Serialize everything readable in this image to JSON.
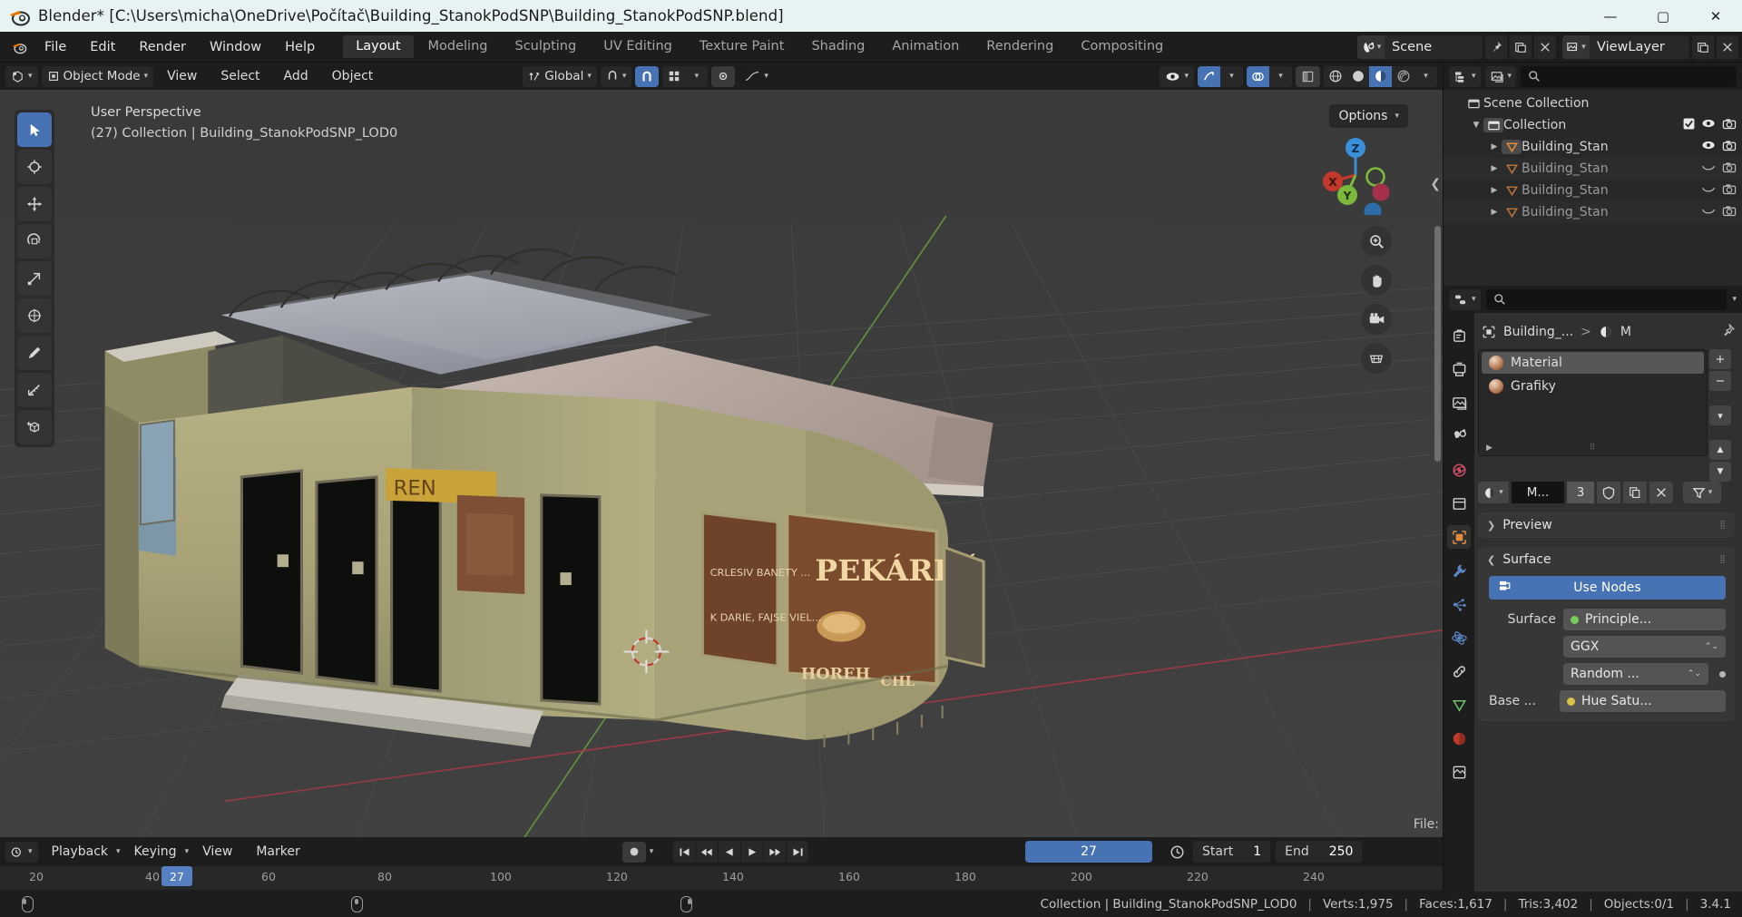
{
  "window": {
    "title": "Blender* [C:\\Users\\micha\\OneDrive\\Počítač\\Building_StanokPodSNP\\Building_StanokPodSNP.blend]",
    "minimize": "—",
    "maximize": "▢",
    "close": "✕"
  },
  "topbar": {
    "menus": [
      "File",
      "Edit",
      "Render",
      "Window",
      "Help"
    ],
    "workspaces": [
      "Layout",
      "Modeling",
      "Sculpting",
      "UV Editing",
      "Texture Paint",
      "Shading",
      "Animation",
      "Rendering",
      "Compositing"
    ],
    "active_workspace": "Layout",
    "scene_name": "Scene",
    "view_layer_name": "ViewLayer",
    "scene_icon": "scene-icon",
    "pin_icon": "pin-icon",
    "new_scene_icon": "new-scene-icon",
    "remove_scene_icon": "remove-scene-icon",
    "view_layer_icon": "view-layer-icon",
    "new_layer_icon": "new-layer-icon",
    "remove_layer_icon": "remove-layer-icon"
  },
  "viewport_header": {
    "editor_type_icon": "editor-type-icon",
    "mode": "Object Mode",
    "menus": [
      "View",
      "Select",
      "Add",
      "Object"
    ],
    "transform_orientation": "Global",
    "snap_icon": "magnet-icon",
    "proportional_icon": "proportional-edit-icon",
    "visibility_icon": "eye-icon",
    "gizmo_icon": "gizmo-icon",
    "overlays_icon": "overlays-icon",
    "xray_icon": "xray-icon",
    "shading_modes": [
      "wireframe",
      "solid",
      "material-preview",
      "rendered"
    ],
    "active_shading": "material-preview",
    "options_label": "Options"
  },
  "viewport": {
    "perspective_label": "User Perspective",
    "collection_label": "(27) Collection | Building_StanokPodSNP_LOD0",
    "gizmo_axes": [
      "Z",
      "X",
      "Y"
    ],
    "file_label": "File:",
    "tools": [
      {
        "name": "tweak-tool",
        "active": true
      },
      {
        "name": "cursor-tool",
        "active": false
      },
      {
        "name": "move-tool",
        "active": false
      },
      {
        "name": "rotate-tool",
        "active": false
      },
      {
        "name": "scale-tool",
        "active": false
      },
      {
        "name": "transform-tool",
        "active": false
      },
      {
        "name": "annotate-tool",
        "active": false
      },
      {
        "name": "measure-tool",
        "active": false
      },
      {
        "name": "add-cube-tool",
        "active": false
      }
    ],
    "nav_buttons": [
      "zoom-icon",
      "pan-icon",
      "camera-icon",
      "ortho-persp-icon"
    ]
  },
  "timeline": {
    "editor_icon": "timeline-editor-icon",
    "menus": [
      "Playback",
      "Keying",
      "View",
      "Marker"
    ],
    "record_icon": "auto-keying-icon",
    "transport": [
      "jump-to-start",
      "prev-keyframe",
      "play-reverse",
      "play",
      "next-keyframe",
      "jump-to-end"
    ],
    "current_frame": "27",
    "clock_icon": "clock-icon",
    "start_label": "Start",
    "start_value": "1",
    "end_label": "End",
    "end_value": "250",
    "ruler_ticks": [
      "20",
      "40",
      "60",
      "80",
      "100",
      "120",
      "140",
      "160",
      "180",
      "200",
      "220",
      "240"
    ],
    "playhead_frame": "27"
  },
  "outliner": {
    "display_mode_icon": "outliner-display-mode-icon",
    "filter_icon": "outliner-filter-icon",
    "search_placeholder": "",
    "search_icon": "search-icon",
    "rows": [
      {
        "name": "Scene Collection",
        "icon": "collection-icon",
        "indent": 0,
        "expander": "",
        "dim": false,
        "checkbox": false,
        "eye": false,
        "camera": false,
        "selected": false
      },
      {
        "name": "Collection",
        "icon": "collection-icon",
        "indent": 1,
        "expander": "▼",
        "dim": false,
        "checkbox": true,
        "eye": "open",
        "camera": true,
        "selected": false
      },
      {
        "name": "Building_Stan",
        "icon": "mesh-icon",
        "indent": 2,
        "expander": "▶",
        "dim": false,
        "checkbox": false,
        "eye": "open",
        "camera": true,
        "selected": true
      },
      {
        "name": "Building_Stan",
        "icon": "mesh-icon",
        "indent": 2,
        "expander": "▶",
        "dim": true,
        "checkbox": false,
        "eye": "closed",
        "camera": true,
        "selected": false
      },
      {
        "name": "Building_Stan",
        "icon": "mesh-icon",
        "indent": 2,
        "expander": "▶",
        "dim": true,
        "checkbox": false,
        "eye": "closed",
        "camera": true,
        "selected": false
      },
      {
        "name": "Building_Stan",
        "icon": "mesh-icon",
        "indent": 2,
        "expander": "▶",
        "dim": true,
        "checkbox": false,
        "eye": "closed",
        "camera": true,
        "selected": false
      }
    ]
  },
  "properties": {
    "editor_icon": "properties-editor-icon",
    "search_icon": "search-icon",
    "tabs": [
      {
        "name": "tool-tab",
        "active": false
      },
      {
        "name": "render-tab",
        "active": false
      },
      {
        "name": "output-tab",
        "active": false
      },
      {
        "name": "view-layer-tab",
        "active": false
      },
      {
        "name": "scene-tab",
        "active": false
      },
      {
        "name": "world-tab",
        "active": false
      },
      {
        "name": "collection-tab",
        "active": false
      },
      {
        "name": "object-tab",
        "active": false
      },
      {
        "name": "modifier-tab",
        "active": false
      },
      {
        "name": "particles-tab",
        "active": false
      },
      {
        "name": "physics-tab",
        "active": false
      },
      {
        "name": "constraint-tab",
        "active": false
      },
      {
        "name": "data-tab",
        "active": false
      },
      {
        "name": "material-tab",
        "active": true
      }
    ],
    "breadcrumb_object": "Building_...",
    "breadcrumb_sep": ">",
    "breadcrumb_material": "M",
    "pin_icon": "pin-icon",
    "material_slots": [
      {
        "name": "Material",
        "selected": true
      },
      {
        "name": "Grafiky",
        "selected": false
      }
    ],
    "slot_buttons": [
      "+",
      "−",
      "⌄",
      "▲",
      "▼"
    ],
    "datablock": {
      "browse_icon": "browse-material-icon",
      "name": "M...",
      "users": "3",
      "shield_icon": "fake-user-icon",
      "copy_icon": "new-material-icon",
      "unlink_icon": "unlink-icon",
      "slot_icon": "material-slot-icon"
    },
    "panels": [
      {
        "label": "Preview",
        "expanded": false
      },
      {
        "label": "Surface",
        "expanded": true
      }
    ],
    "use_nodes_label": "Use Nodes",
    "surface_rows": [
      {
        "label": "Surface",
        "value": "Principle...",
        "dot": "green"
      },
      {
        "label": "",
        "value": "GGX",
        "dot": "none"
      },
      {
        "label": "",
        "value": "Random ...",
        "dot": "none"
      },
      {
        "label": "Base ...",
        "value": "Hue Satu...",
        "dot": "yellow"
      }
    ]
  },
  "statusbar": {
    "mouse_hints": [
      "select",
      "",
      ""
    ],
    "scene_stats": "Collection | Building_StanokPodSNP_LOD0",
    "verts": "Verts:1,975",
    "faces": "Faces:1,617",
    "tris": "Tris:3,402",
    "objects": "Objects:0/1",
    "version": "3.4.1"
  },
  "colors": {
    "accent_blue": "#4772b3",
    "panel_bg": "#303030",
    "editor_bg": "#1d1d1d",
    "viewport_bg": "#3d3d3d",
    "title_bg": "#e7f3f2"
  }
}
